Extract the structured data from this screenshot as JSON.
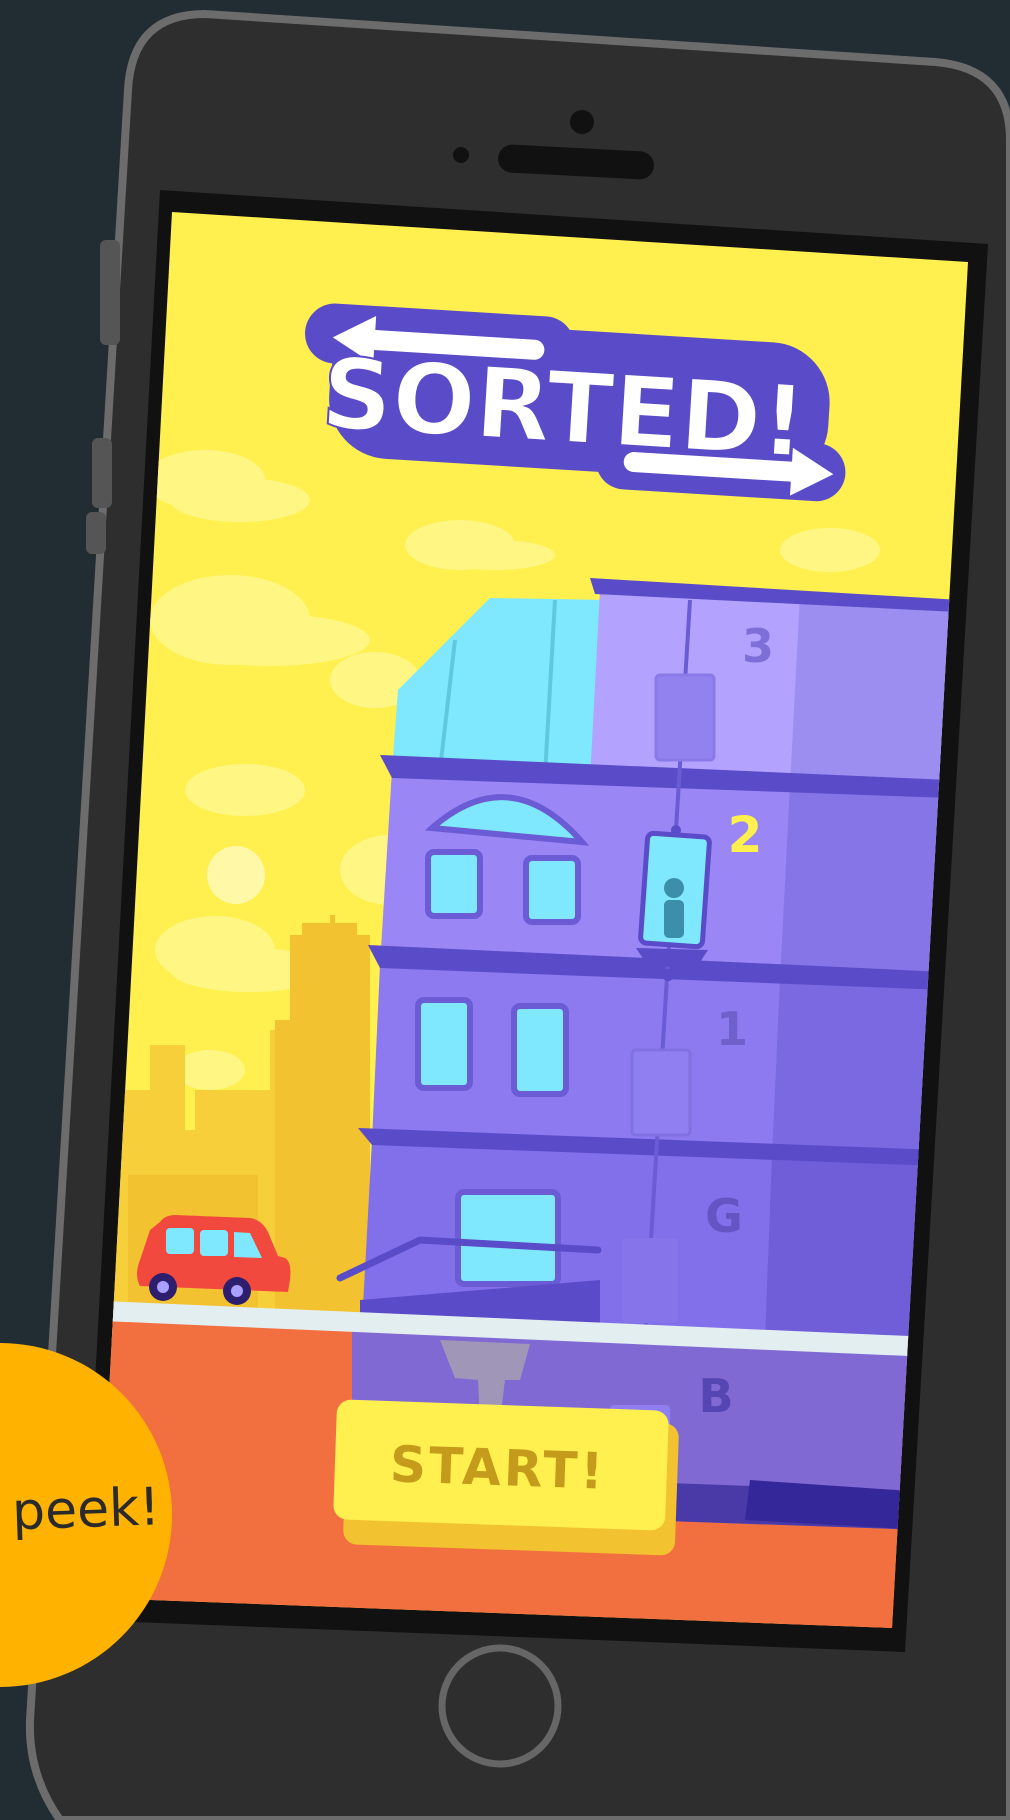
{
  "game": {
    "title": "SORTED!",
    "start_button_label": "START!",
    "peek_label": "peek!",
    "floors": [
      "3",
      "2",
      "1",
      "G",
      "B"
    ],
    "current_floor": "2"
  },
  "colors": {
    "background": "#222c33",
    "phone_body": "#2e2e2e",
    "phone_edge": "#6c6c6c",
    "screen_sky": "#fff04f",
    "building": "#9a86f4",
    "building_dark": "#5b4cc4",
    "glass": "#7fe8ff",
    "ground": "#f26f3f",
    "car": "#f2493f",
    "start_button": "#fff04f",
    "start_text": "#c49b1a",
    "peek_badge": "#ffb300",
    "floor_current": "#fff04f"
  }
}
